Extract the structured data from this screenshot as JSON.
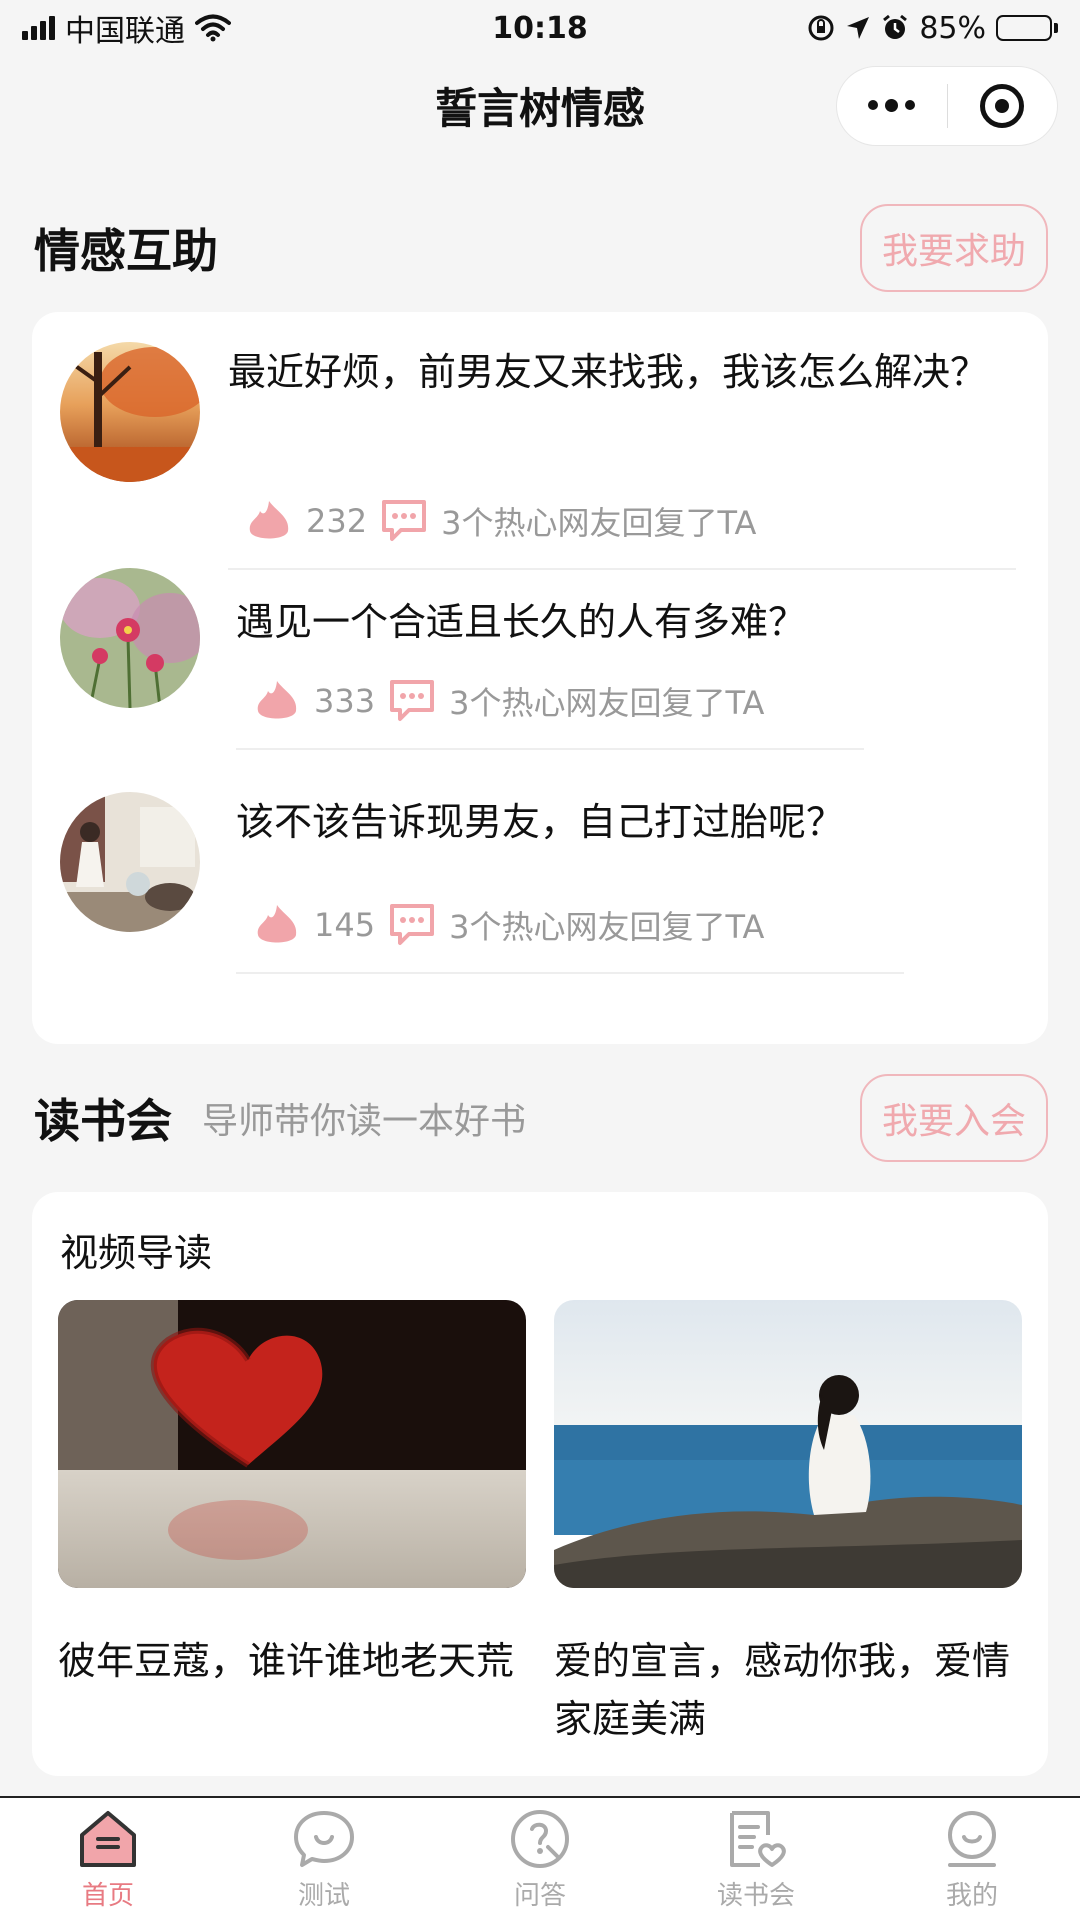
{
  "status_bar": {
    "carrier": "中国联通",
    "time": "10:18",
    "battery": "85%",
    "battery_level": 0.85
  },
  "header": {
    "title": "誓言树情感"
  },
  "help_section": {
    "title": "情感互助",
    "button_label": "我要求助",
    "posts": [
      {
        "title": "最近好烦，前男友又来找我，我该怎么解决？",
        "likes": "232",
        "replies": "3个热心网友回复了TA",
        "avatar": "autumn-tree-avatar"
      },
      {
        "title": "遇见一个合适且长久的人有多难？",
        "likes": "333",
        "replies": "3个热心网友回复了TA",
        "avatar": "pink-flowers-avatar"
      },
      {
        "title": "该不该告诉现男友，自己打过胎呢？",
        "likes": "145",
        "replies": "3个热心网友回复了TA",
        "avatar": "girl-room-avatar"
      }
    ]
  },
  "book_club": {
    "title": "读书会",
    "subtitle": "导师带你读一本好书",
    "button_label": "我要入会",
    "video_label": "视频导读",
    "videos": [
      {
        "title": "彼年豆蔻，谁许谁地老天荒",
        "image": "red-heart-image"
      },
      {
        "title": "爱的宣言，感动你我，爱情家庭美满",
        "image": "girl-by-sea-image"
      }
    ]
  },
  "tab_bar": {
    "tabs": [
      {
        "label": "首页",
        "icon": "home-icon",
        "active": true
      },
      {
        "label": "测试",
        "icon": "test-icon",
        "active": false
      },
      {
        "label": "问答",
        "icon": "qa-icon",
        "active": false
      },
      {
        "label": "读书会",
        "icon": "book-club-icon",
        "active": false
      },
      {
        "label": "我的",
        "icon": "profile-icon",
        "active": false
      }
    ]
  },
  "colors": {
    "accent": "#e87a82",
    "pill_border": "#f0b7bc",
    "like": "#f1a5aa"
  }
}
